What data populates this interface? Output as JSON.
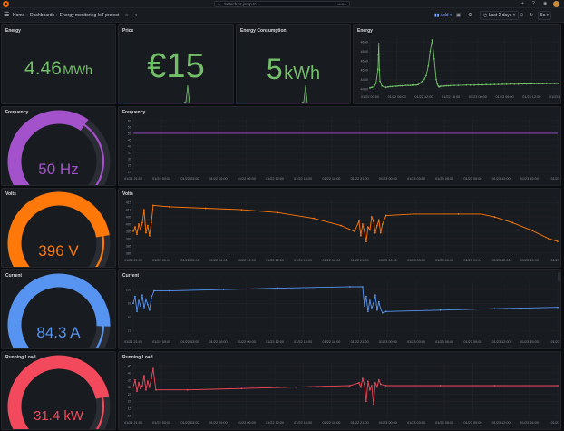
{
  "topbar": {
    "search_placeholder": "Search or jump to...",
    "search_shortcut": "ctrl+k",
    "icons": [
      "plus-icon",
      "help-icon",
      "rss-icon",
      "avatar"
    ]
  },
  "navbar": {
    "breadcrumbs": [
      "Home",
      "Dashboards",
      "Energy monitoring IoT project"
    ],
    "add_label": "Add",
    "time_range": "Last 2 days",
    "refresh": "5s"
  },
  "colors": {
    "green": "#73bf69",
    "purple": "#a352cc",
    "orange": "#ff780a",
    "blue": "#5794f2",
    "red": "#f2495c",
    "track": "#2a2d33"
  },
  "panels": {
    "energy_stat": {
      "title": "Energy",
      "value": "4.46",
      "unit": "MWh"
    },
    "price_stat": {
      "title": "Price",
      "value": "€15"
    },
    "consumption_stat": {
      "title": "Energy Consumption",
      "value": "5",
      "unit": "kWh"
    },
    "energy_chart": {
      "title": "Energy"
    },
    "frequency_gauge": {
      "title": "Frequency",
      "value": "50 Hz",
      "fill": 0.63
    },
    "frequency_chart": {
      "title": "Frequency"
    },
    "volts_gauge": {
      "title": "Volts",
      "value": "396 V",
      "fill": 0.8
    },
    "volts_chart": {
      "title": "Volts"
    },
    "current_gauge": {
      "title": "Current",
      "value": "84.3 A",
      "fill": 0.84
    },
    "current_chart": {
      "title": "Current"
    },
    "load_gauge": {
      "title": "Running Load",
      "value": "31.4 kW",
      "fill": 0.79
    },
    "load_chart": {
      "title": "Running Load"
    }
  },
  "time_ticks_main": [
    "01/21 21:00",
    "01/22 00:00",
    "01/22 03:00",
    "01/22 06:00",
    "01/22 09:00",
    "01/22 12:00",
    "01/22 15:00",
    "01/22 18:00",
    "01/22 21:00",
    "01/23 00:00",
    "01/23 03:00",
    "01/23 06:00",
    "01/23 09:00",
    "01/23 12:00",
    "01/23 15:00",
    "01/23 18"
  ],
  "time_ticks_energy": [
    "01/22 00:00",
    "01/22 06:00",
    "01/22 12:00",
    "01/22 18:00",
    "01/23 00:00",
    "01/23 06:00",
    "01/23 12:00",
    "01/23 18:00"
  ],
  "chart_data": [
    {
      "type": "line",
      "title": "Energy",
      "y_ticks": [
        "4400",
        "4450",
        "4500",
        "4550",
        "4600",
        "4650"
      ],
      "ylim": [
        4380,
        4670
      ],
      "x": [
        0.0,
        0.5,
        1.0,
        1.5,
        2.0,
        2.1,
        2.2,
        2.35,
        2.5,
        3.0,
        3.5,
        4.0,
        4.5,
        5.0,
        5.5,
        6.0,
        6.5,
        7.0,
        7.5,
        8.0,
        8.5,
        9.0,
        9.5,
        10.0,
        10.5,
        11.0,
        11.5,
        12.0,
        12.5,
        13.0,
        13.5,
        14.0,
        14.5,
        15.0,
        15.5,
        16.0,
        16.5,
        16.8,
        17.0,
        17.2,
        17.4,
        17.6,
        18.0,
        18.5,
        19.0,
        19.5,
        20.0,
        21.0,
        22.0,
        23.0,
        24.0,
        25.0,
        26.0,
        27.0,
        28.0,
        29.0,
        30.0,
        31.0,
        32.0,
        33.0,
        34.0,
        35.0,
        36.0,
        37.0,
        38.0,
        39.0,
        40.0,
        41.0,
        42.0,
        43.0,
        44.0,
        45.0,
        46.0,
        47.0
      ],
      "y": [
        4405,
        4408,
        4410,
        4430,
        4505,
        4580,
        4640,
        4500,
        4440,
        4415,
        4410,
        4408,
        4410,
        4412,
        4412,
        4414,
        4414,
        4415,
        4416,
        4416,
        4417,
        4418,
        4418,
        4418,
        4419,
        4420,
        4420,
        4422,
        4430,
        4440,
        4450,
        4470,
        4520,
        4600,
        4660,
        4560,
        4450,
        4425,
        4415,
        4410,
        4412,
        4414,
        4414,
        4415,
        4416,
        4416,
        4417,
        4418,
        4418,
        4419,
        4420,
        4420,
        4420,
        4421,
        4421,
        4422,
        4422,
        4423,
        4423,
        4424,
        4424,
        4425,
        4425,
        4425,
        4426,
        4426,
        4426,
        4427,
        4427,
        4427,
        4428,
        4428,
        4428,
        4428
      ]
    },
    {
      "type": "line",
      "title": "Frequency",
      "y_ticks": [
        "60",
        "55",
        "50",
        "45",
        "40",
        "35",
        "30",
        "25",
        "20"
      ],
      "ylim": [
        18,
        62
      ],
      "x": [
        0,
        47
      ],
      "y": [
        50,
        50
      ]
    },
    {
      "type": "line",
      "title": "Volts",
      "y_ticks": [
        "415",
        "410",
        "405",
        "400",
        "395",
        "390",
        "385",
        "380"
      ],
      "ylim": [
        378,
        417
      ],
      "x": [
        0.0,
        0.2,
        0.4,
        0.6,
        0.8,
        1.0,
        1.2,
        1.4,
        1.6,
        1.8,
        2.0,
        2.2,
        4,
        8,
        12,
        16,
        20,
        23,
        24.5,
        25.0,
        25.2,
        25.4,
        25.6,
        25.8,
        26.0,
        26.2,
        26.4,
        26.6,
        26.8,
        27.0,
        27.2,
        27.4,
        27.6,
        28,
        31,
        36,
        38.5,
        40,
        42,
        44,
        46,
        47
      ],
      "y": [
        395,
        398,
        393,
        400,
        396,
        401,
        410,
        394,
        399,
        392,
        401,
        413,
        412,
        411,
        410,
        408,
        404,
        399,
        395,
        402,
        392,
        400,
        395,
        388,
        398,
        396,
        405,
        402,
        394,
        399,
        403,
        394,
        400,
        406,
        407,
        407,
        407,
        405,
        401,
        396,
        390,
        388
      ]
    },
    {
      "type": "line",
      "title": "Current",
      "y_ticks": [
        "100",
        "90",
        "80",
        "70"
      ],
      "ylim": [
        65,
        106
      ],
      "x": [
        0.0,
        0.2,
        0.4,
        0.6,
        0.8,
        1.0,
        1.2,
        1.4,
        1.6,
        1.8,
        2.0,
        2.3,
        4,
        10,
        16,
        24,
        25.4,
        25.6,
        25.8,
        26.0,
        26.2,
        26.4,
        26.6,
        26.8,
        27.0,
        27.2,
        27.4,
        27.6,
        28,
        34,
        40,
        47
      ],
      "y": [
        90,
        95,
        84,
        92,
        88,
        96,
        86,
        93,
        89,
        85,
        94,
        99,
        99,
        100,
        101,
        102,
        102,
        88,
        95,
        84,
        92,
        86,
        90,
        96,
        85,
        91,
        86,
        83,
        84,
        85,
        86,
        87
      ]
    },
    {
      "type": "line",
      "title": "Running Load",
      "y_ticks": [
        "45",
        "40",
        "35",
        "30",
        "25",
        "20",
        "15",
        "10"
      ],
      "ylim": [
        8,
        47
      ],
      "x": [
        0.0,
        0.2,
        0.4,
        0.6,
        0.8,
        1.0,
        1.2,
        1.4,
        1.6,
        1.8,
        2.0,
        2.2,
        2.5,
        6,
        12,
        18,
        24,
        25.0,
        25.2,
        25.4,
        25.6,
        25.8,
        26.0,
        26.2,
        26.4,
        26.6,
        26.8,
        27.0,
        27.2,
        27.4,
        28,
        34,
        40,
        47
      ],
      "y": [
        30,
        35,
        27,
        33,
        29,
        31,
        38,
        28,
        34,
        30,
        36,
        43,
        28,
        28,
        29,
        30,
        31,
        33,
        30,
        36,
        32,
        20,
        34,
        28,
        31,
        18,
        33,
        30,
        35,
        32,
        31,
        31,
        31,
        31
      ]
    }
  ]
}
